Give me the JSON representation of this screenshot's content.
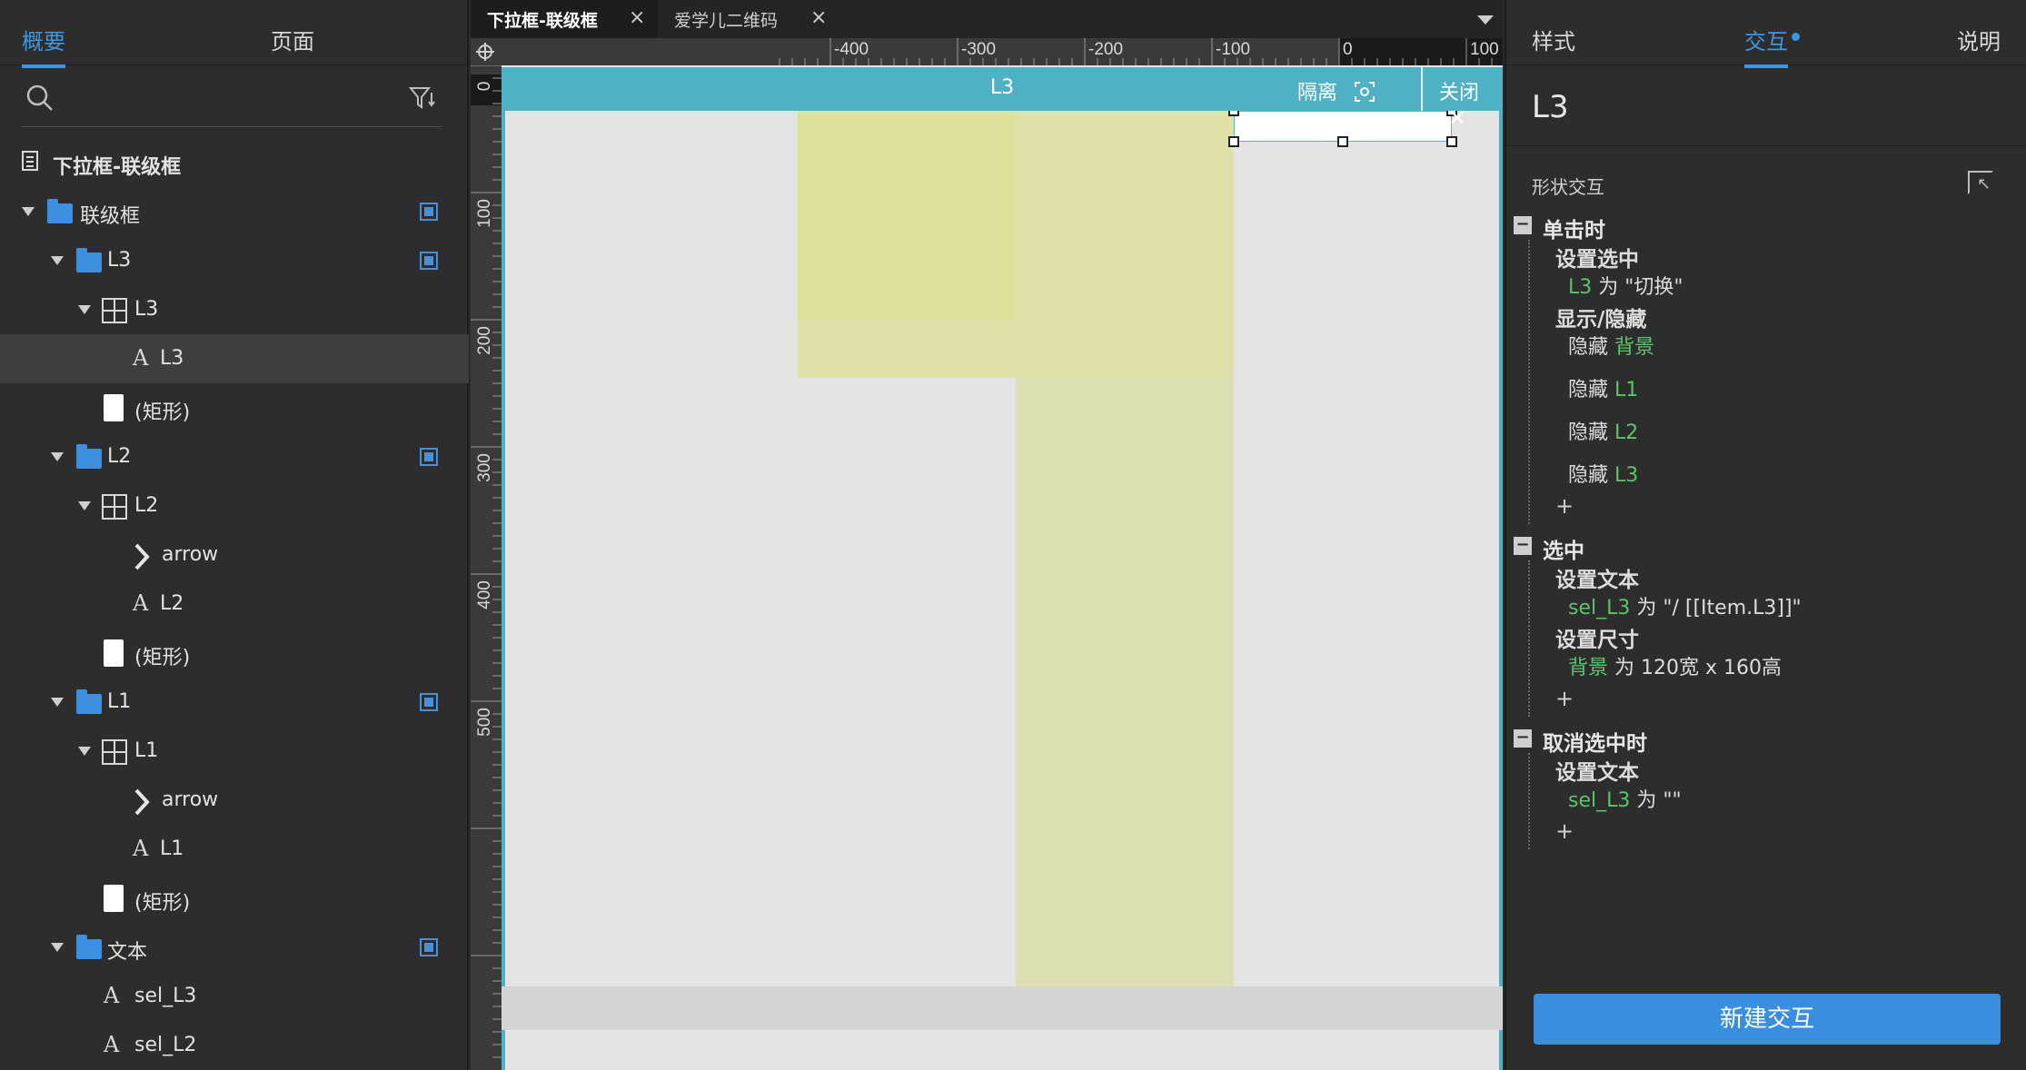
{
  "left_panel": {
    "tabs": [
      "概要",
      "页面"
    ],
    "tree": [
      {
        "label": "下拉框-联级框",
        "icon": "page-icon"
      },
      {
        "label": "联级框",
        "icon": "folder-icon"
      },
      {
        "label": "L3",
        "icon": "folder-icon"
      },
      {
        "label": "L3",
        "icon": "repeater-icon"
      },
      {
        "label": "L3",
        "icon": "text-icon"
      },
      {
        "label": "(矩形)",
        "icon": "rectangle-icon"
      },
      {
        "label": "L2",
        "icon": "folder-icon"
      },
      {
        "label": "L2",
        "icon": "repeater-icon"
      },
      {
        "label": "arrow",
        "icon": "chevron-right-icon"
      },
      {
        "label": "L2",
        "icon": "text-icon"
      },
      {
        "label": "(矩形)",
        "icon": "rectangle-icon"
      },
      {
        "label": "L1",
        "icon": "folder-icon"
      },
      {
        "label": "L1",
        "icon": "repeater-icon"
      },
      {
        "label": "arrow",
        "icon": "chevron-right-icon"
      },
      {
        "label": "L1",
        "icon": "text-icon"
      },
      {
        "label": "(矩形)",
        "icon": "rectangle-icon"
      },
      {
        "label": "文本",
        "icon": "folder-icon"
      },
      {
        "label": "sel_L3",
        "icon": "text-icon"
      },
      {
        "label": "sel_L2",
        "icon": "text-icon"
      }
    ]
  },
  "doc_tabs": [
    "下拉框-联级框",
    "爱学儿二维码"
  ],
  "ruler": {
    "top_labels": [
      "-400",
      "-300",
      "-200",
      "-100",
      "0",
      "100"
    ],
    "left_labels": [
      "0",
      "100",
      "200",
      "300",
      "400",
      "500"
    ]
  },
  "canvas": {
    "isolation_title": "L3",
    "isolate_label": "隔离",
    "close_label": "关闭"
  },
  "right_panel": {
    "tabs": [
      "样式",
      "交互",
      "说明"
    ],
    "selected_name": "L3",
    "section_label": "形状交互",
    "events": [
      {
        "name": "单击时",
        "actions": [
          {
            "name": "设置选中",
            "lines": [
              [
                "L3",
                " 为 \"切换\""
              ]
            ]
          },
          {
            "name": "显示/隐藏",
            "lines": [
              [
                "隐藏 ",
                "背景"
              ],
              [
                "隐藏 ",
                "L1"
              ],
              [
                "隐藏 ",
                "L2"
              ],
              [
                "隐藏 ",
                "L3"
              ]
            ]
          }
        ]
      },
      {
        "name": "选中",
        "actions": [
          {
            "name": "设置文本",
            "lines": [
              [
                "sel_L3",
                " 为 \"/ [[Item.L3]]\""
              ]
            ]
          },
          {
            "name": "设置尺寸",
            "lines": [
              [
                "背景",
                " 为 120宽 x 160高"
              ]
            ]
          }
        ]
      },
      {
        "name": "取消选中时",
        "actions": [
          {
            "name": "设置文本",
            "lines": [
              [
                "sel_L3",
                " 为 \"\""
              ]
            ]
          }
        ]
      }
    ],
    "new_interaction_label": "新建交互"
  },
  "colors": {
    "accent": "#3f95e0",
    "isolation_bar": "#4fb1c4",
    "target_green": "#5cc46a"
  }
}
